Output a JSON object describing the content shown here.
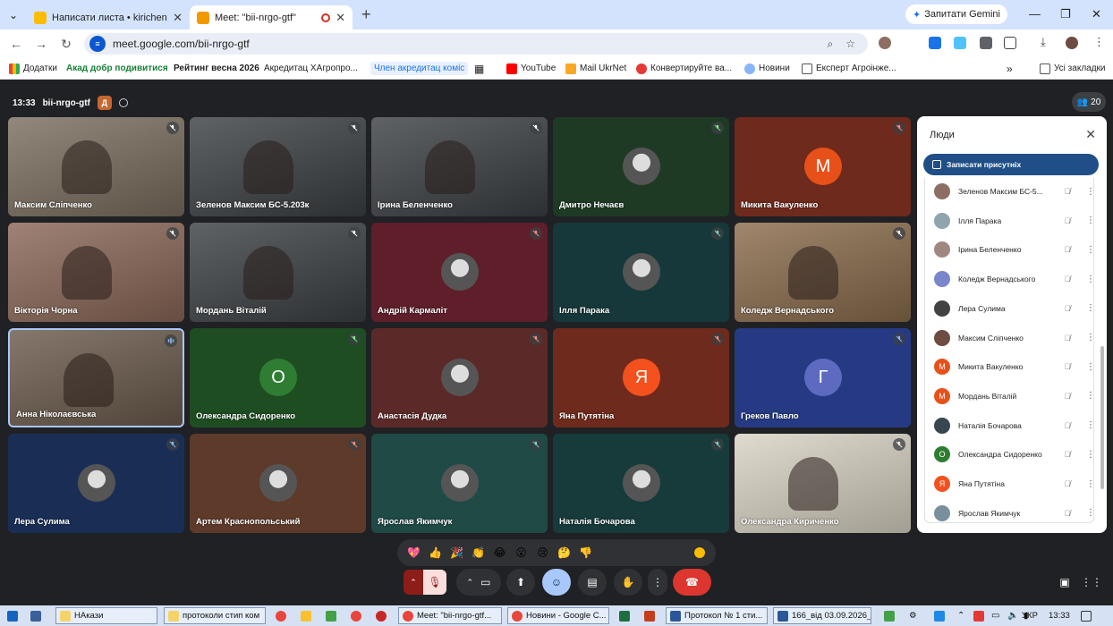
{
  "browser": {
    "tabs": [
      {
        "title": "Написати листа • kirichenko.ol",
        "active": false,
        "favicon_color": "#fbbc04"
      },
      {
        "title": "Meet: \"bii-nrgo-gtf\"",
        "active": true,
        "favicon_color": "#f29900"
      }
    ],
    "gemini_label": "Запитати Gemini",
    "url": "meet.google.com/bii-nrgo-gtf",
    "bookmarks": [
      {
        "label": "Додатки",
        "icon": "apps-grid-icon"
      },
      {
        "label": "Акад добр подивитися",
        "color": "#188038"
      },
      {
        "label": "Рейтинг весна 2026",
        "color": "#333"
      },
      {
        "label": "Акредитац ХАгропро...",
        "color": "#333"
      },
      {
        "label": "Член акредитац коміс",
        "color": "#1a73e8"
      },
      {
        "label": "YouTube"
      },
      {
        "label": "Mail UkrNet"
      },
      {
        "label": "Конвертируйте ва..."
      },
      {
        "label": "Новини"
      },
      {
        "label": "Експерт Агроінже..."
      },
      {
        "label": "Усі закладки"
      }
    ]
  },
  "meet": {
    "time": "13:33",
    "code": "bii-nrgo-gtf",
    "badge_letter": "Д",
    "participant_count": "20",
    "tiles": [
      {
        "name": "Максим Сліпченко",
        "bg": "#7a6e5f",
        "kind": "photo",
        "mic": "muted"
      },
      {
        "name": "Зеленов Максим БС-5.203к",
        "bg": "#3c4043",
        "kind": "photo",
        "mic": "muted"
      },
      {
        "name": "Ірина Беленченко",
        "bg": "#3c4043",
        "kind": "photo",
        "mic": "muted"
      },
      {
        "name": "Дмитро Нечаєв",
        "bg": "#1e3a25",
        "kind": "avatar",
        "mic": "muted-green"
      },
      {
        "name": "Микита Вакуленко",
        "bg": "#6e2a1c",
        "kind": "letter",
        "letter": "М",
        "letter_bg": "#e8501a",
        "mic": "muted-red"
      },
      {
        "name": "Вікторія Чорна",
        "bg": "#8a6757",
        "kind": "photo",
        "mic": "muted"
      },
      {
        "name": "Мордань Віталій",
        "bg": "#3c4043",
        "kind": "photo",
        "mic": "muted"
      },
      {
        "name": "Андрій Кармаліт",
        "bg": "#5e1f2b",
        "kind": "avatar",
        "mic": "muted-red"
      },
      {
        "name": "Ілля Парака",
        "bg": "#17383a",
        "kind": "avatar",
        "mic": "muted-teal"
      },
      {
        "name": "Коледж Вернадського",
        "bg": "#8a6c4c",
        "kind": "photo",
        "mic": "muted"
      },
      {
        "name": "Анна Ніколаєвська",
        "bg": "#6b5a4b",
        "kind": "photo",
        "mic": "speaking"
      },
      {
        "name": "Олександра Сидоренко",
        "bg": "#1f4d22",
        "kind": "letter",
        "letter": "О",
        "letter_bg": "#2e7d32",
        "mic": "muted-green"
      },
      {
        "name": "Анастасія Дудка",
        "bg": "#5b2a28",
        "kind": "avatar",
        "mic": "muted-red"
      },
      {
        "name": "Яна Путятіна",
        "bg": "#6e2a1c",
        "kind": "letter",
        "letter": "Я",
        "letter_bg": "#f4511e",
        "mic": "muted-red"
      },
      {
        "name": "Греков Павло",
        "bg": "#263a84",
        "kind": "letter",
        "letter": "Г",
        "letter_bg": "#5c6bc0",
        "mic": "muted-blue"
      },
      {
        "name": "Лера Сулима",
        "bg": "#1a2e55",
        "kind": "avatar",
        "mic": "muted-blue"
      },
      {
        "name": "Артем Краснопольський",
        "bg": "#5e3a2a",
        "kind": "avatar",
        "mic": "muted-red"
      },
      {
        "name": "Ярослав Якимчук",
        "bg": "#1f4a46",
        "kind": "avatar",
        "mic": "muted-teal"
      },
      {
        "name": "Наталія Бочарова",
        "bg": "#173a3a",
        "kind": "avatar",
        "mic": "muted-teal"
      },
      {
        "name": "Олександра Кириченко",
        "bg": "#d9d3c4",
        "kind": "photo",
        "mic": "muted"
      }
    ],
    "people_panel": {
      "title": "Люди",
      "record_attendance": "Записати присутніх",
      "items": [
        {
          "name": "Зеленов Максим БС-5...",
          "avatar_bg": "#8d6e63",
          "letter": ""
        },
        {
          "name": "Ілля Парака",
          "avatar_bg": "#90a4ae",
          "letter": ""
        },
        {
          "name": "Ірина Беленченко",
          "avatar_bg": "#a1887f",
          "letter": ""
        },
        {
          "name": "Коледж Вернадського",
          "avatar_bg": "#7986cb",
          "letter": ""
        },
        {
          "name": "Лера Сулима",
          "avatar_bg": "#424242",
          "letter": ""
        },
        {
          "name": "Максим Сліпченко",
          "avatar_bg": "#6d4c41",
          "letter": ""
        },
        {
          "name": "Микита Вакуленко",
          "avatar_bg": "#e8501a",
          "letter": "М"
        },
        {
          "name": "Мордань Віталій",
          "avatar_bg": "#e8501a",
          "letter": "М"
        },
        {
          "name": "Наталія Бочарова",
          "avatar_bg": "#37474f",
          "letter": ""
        },
        {
          "name": "Олександра Сидоренко",
          "avatar_bg": "#2e7d32",
          "letter": "О"
        },
        {
          "name": "Яна Путятіна",
          "avatar_bg": "#f4511e",
          "letter": "Я"
        },
        {
          "name": "Ярослав Якимчук",
          "avatar_bg": "#78909c",
          "letter": ""
        }
      ]
    },
    "reactions": [
      "💖",
      "👍",
      "🎉",
      "👏",
      "😂",
      "😮",
      "😢",
      "🤔",
      "👎"
    ]
  },
  "taskbar": {
    "items": [
      {
        "label": "НАкази",
        "color": "#f5d36b"
      },
      {
        "label": "протоколи стип ком",
        "color": "#f5d36b"
      },
      {
        "label": "Meet: \"bii-nrgo-gtf...",
        "color": "#e8453c"
      },
      {
        "label": "Новини - Google C...",
        "color": "#e8453c"
      },
      {
        "label": "Протокол № 1 сти...",
        "color": "#2b579a"
      },
      {
        "label": "166_від 03.09.2026_...",
        "color": "#2b579a"
      }
    ],
    "lang": "УКР",
    "clock": "13:33"
  }
}
